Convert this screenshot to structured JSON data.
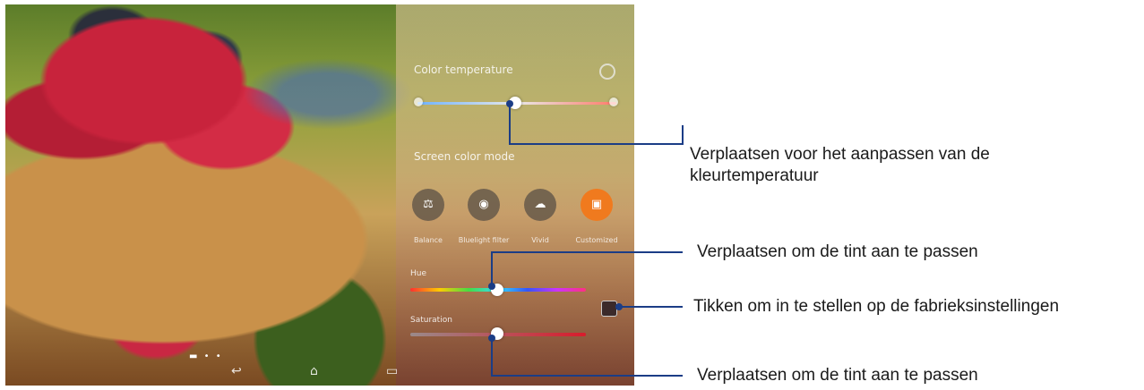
{
  "panel": {
    "color_temperature_title": "Color temperature",
    "screen_color_mode_title": "Screen color mode",
    "modes": [
      {
        "label": "Balance",
        "icon": "balance-icon",
        "selected": false
      },
      {
        "label": "Bluelight filter",
        "icon": "eye-icon",
        "selected": false
      },
      {
        "label": "Vivid",
        "icon": "cloud-icon",
        "selected": false
      },
      {
        "label": "Customized",
        "icon": "custom-icon",
        "selected": true
      }
    ],
    "hue_label": "Hue",
    "saturation_label": "Saturation",
    "accent_color": "#f07a1e"
  },
  "callouts": {
    "temperature": "Verplaatsen voor het aanpassen van de kleurtemperatuur",
    "hue": "Verplaatsen om de tint aan te passen",
    "reset": "Tikken om in te stellen op de fabrieksinstellingen",
    "saturation": "Verplaatsen om de tint aan te passen"
  },
  "navbar": {
    "icons": [
      "back-icon",
      "home-icon",
      "recent-apps-icon"
    ]
  },
  "values": {
    "color_temperature": 0.48,
    "hue": 0.48,
    "saturation": 0.48
  }
}
